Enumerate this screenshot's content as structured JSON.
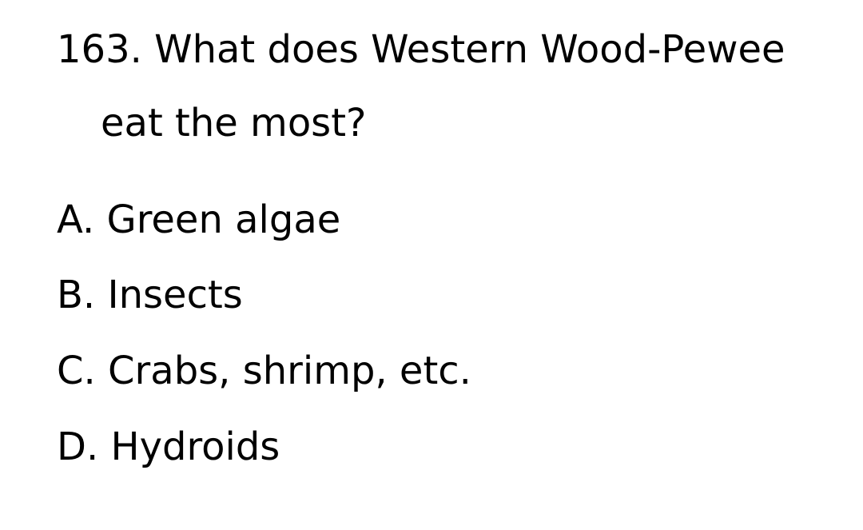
{
  "question": {
    "line1": "163. What does Western Wood-Pewee",
    "line2": "eat the most?"
  },
  "options": [
    {
      "text": "A. Green algae"
    },
    {
      "text": "B. Insects"
    },
    {
      "text": "C. Crabs, shrimp, etc."
    },
    {
      "text": "D. Hydroids"
    }
  ]
}
